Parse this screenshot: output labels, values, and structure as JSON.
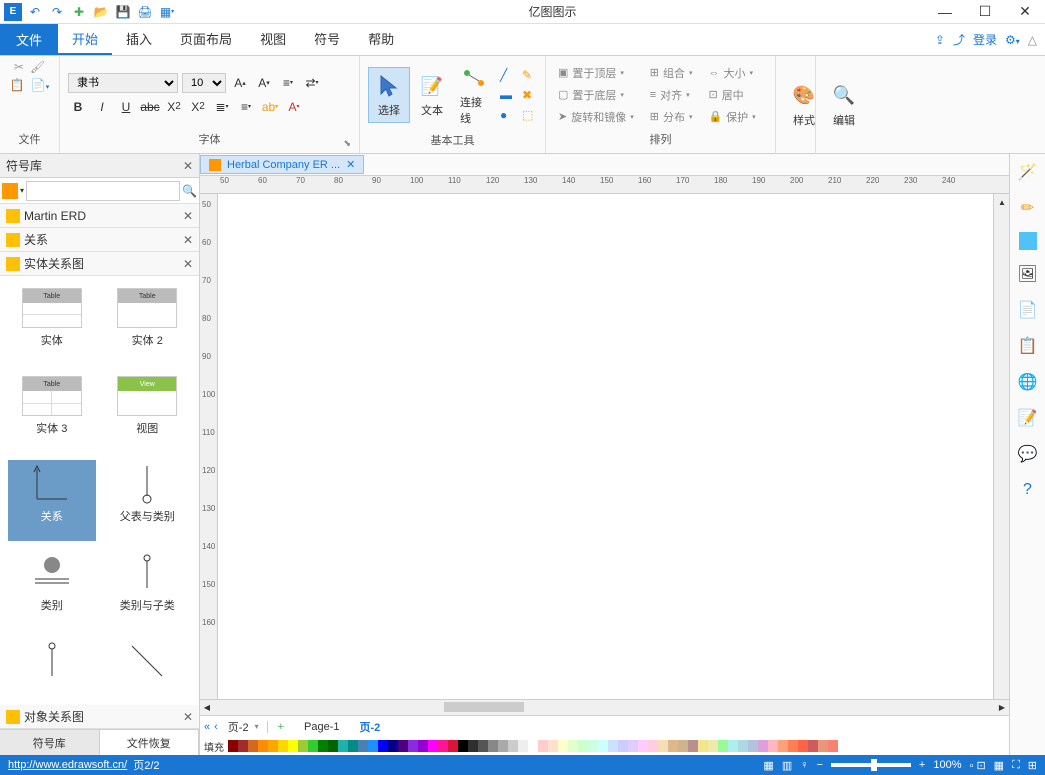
{
  "app": {
    "title": "亿图图示"
  },
  "menu": {
    "file": "文件",
    "tabs": [
      "开始",
      "插入",
      "页面布局",
      "视图",
      "符号",
      "帮助"
    ],
    "login": "登录"
  },
  "ribbon": {
    "file_group": "文件",
    "font_group": "字体",
    "font_name": "隶书",
    "font_size": "10",
    "tools_group": "基本工具",
    "select": "选择",
    "text": "文本",
    "connector": "连接线",
    "arrange_group": "排列",
    "bring_front": "置于顶层",
    "send_back": "置于底层",
    "rotate_flip": "旋转和镜像",
    "group": "组合",
    "align": "对齐",
    "distribute": "分布",
    "size": "大小",
    "center": "居中",
    "protect": "保护",
    "style": "样式",
    "edit": "编辑"
  },
  "symbols": {
    "title": "符号库",
    "sections": {
      "martin": "Martin ERD",
      "relation": "关系",
      "erd": "实体关系图",
      "ord": "对象关系图"
    },
    "shapes": {
      "entity": "实体",
      "entity2": "实体 2",
      "entity3": "实体 3",
      "view": "视图",
      "view_thumb": "View",
      "table_thumb": "Table",
      "relation": "关系",
      "parent_child": "父表与类别",
      "category": "类别",
      "cat_sub": "类别与子类"
    },
    "tabs": {
      "lib": "符号库",
      "recover": "文件恢复"
    }
  },
  "doc": {
    "tab_name": "Herbal Company ER ..."
  },
  "ruler_h": [
    "50",
    "60",
    "70",
    "80",
    "90",
    "100",
    "110",
    "120",
    "130",
    "140",
    "150",
    "160",
    "170",
    "180",
    "190",
    "200",
    "210",
    "220",
    "230",
    "240"
  ],
  "ruler_v": [
    "50",
    "60",
    "70",
    "80",
    "90",
    "100",
    "110",
    "120",
    "130",
    "140",
    "150",
    "160"
  ],
  "pages": {
    "current": "页-2",
    "page1": "Page-1",
    "page2": "页-2"
  },
  "colors": {
    "fill_label": "填充"
  },
  "status": {
    "url": "http://www.edrawsoft.cn/",
    "page": "页2/2",
    "zoom": "100%"
  }
}
